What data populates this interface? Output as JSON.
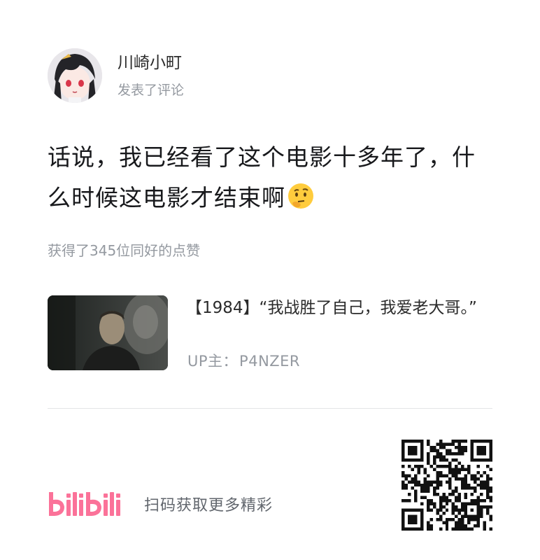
{
  "user": {
    "name": "川崎小町",
    "action": "发表了评论"
  },
  "comment": {
    "text": "话说，我已经看了这个电影十多年了，什么时候这电影才结束啊",
    "emoji": "thinking-face-emoji"
  },
  "likes_text": "获得了345位同好的点赞",
  "video": {
    "title": "【1984】“我战胜了自己，我爱老大哥。”",
    "uploader_label": "UP主：",
    "uploader_name": "P4NZER"
  },
  "footer": {
    "logo_text": "bilibili",
    "scan_text": "扫码获取更多精彩",
    "brand_color": "#fb7299"
  }
}
